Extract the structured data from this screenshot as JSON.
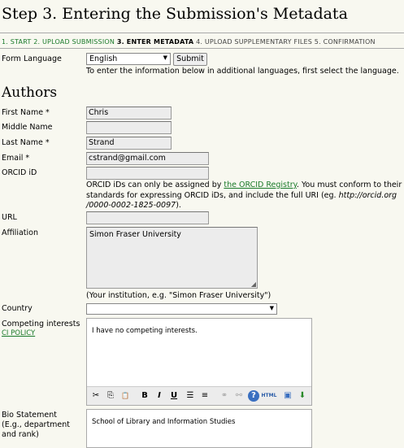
{
  "page_title": "Step 3. Entering the Submission's Metadata",
  "steps": {
    "s1": "1. START",
    "s2": "2. UPLOAD SUBMISSION",
    "s3": "3. ENTER METADATA",
    "s4": "4. UPLOAD SUPPLEMENTARY FILES",
    "s5": "5. CONFIRMATION"
  },
  "form_language": {
    "label": "Form Language",
    "selected": "English",
    "submit_label": "Submit",
    "help": "To enter the information below in additional languages, first select the language."
  },
  "authors_heading": "Authors",
  "fields": {
    "first_name": {
      "label": "First Name *",
      "value": "Chris"
    },
    "middle_name": {
      "label": "Middle Name",
      "value": ""
    },
    "last_name": {
      "label": "Last Name *",
      "value": "Strand"
    },
    "email": {
      "label": "Email *",
      "value": "cstrand@gmail.com"
    },
    "orcid": {
      "label": "ORCID iD",
      "value": ""
    },
    "url": {
      "label": "URL",
      "value": ""
    },
    "affiliation": {
      "label": "Affiliation",
      "value": "Simon Fraser University"
    },
    "country": {
      "label": "Country",
      "value": ""
    },
    "competing": {
      "label": "Competing interests",
      "policy_link": "CI POLICY",
      "value": "I have no competing interests."
    },
    "bio": {
      "label_1": "Bio Statement",
      "label_2": "(E.g., department",
      "label_3": "and rank)",
      "value": "School of Library and Information Studies"
    }
  },
  "orcid_help": {
    "part1": "ORCID iDs can only be assigned by ",
    "link": "the ORCID Registry",
    "part2": ". You must conform to their",
    "line2": "standards for expressing ORCID iDs, and include the full URI (eg. ",
    "example_a": "http://orcid.org",
    "example_b": "/0000-0002-1825-0097",
    "line3_end": ")."
  },
  "affiliation_help": "(Your institution, e.g. \"Simon Fraser University\")",
  "toolbar": {
    "cut": "✂",
    "copy": "⎘",
    "paste": "📋",
    "bold": "B",
    "italic": "I",
    "underline": "U",
    "bullets": "☰",
    "numbers": "≡",
    "link": "⚭",
    "unlink": "⚯",
    "help": "?",
    "html": "HTML",
    "fullscreen": "▣",
    "image": "⬇"
  }
}
